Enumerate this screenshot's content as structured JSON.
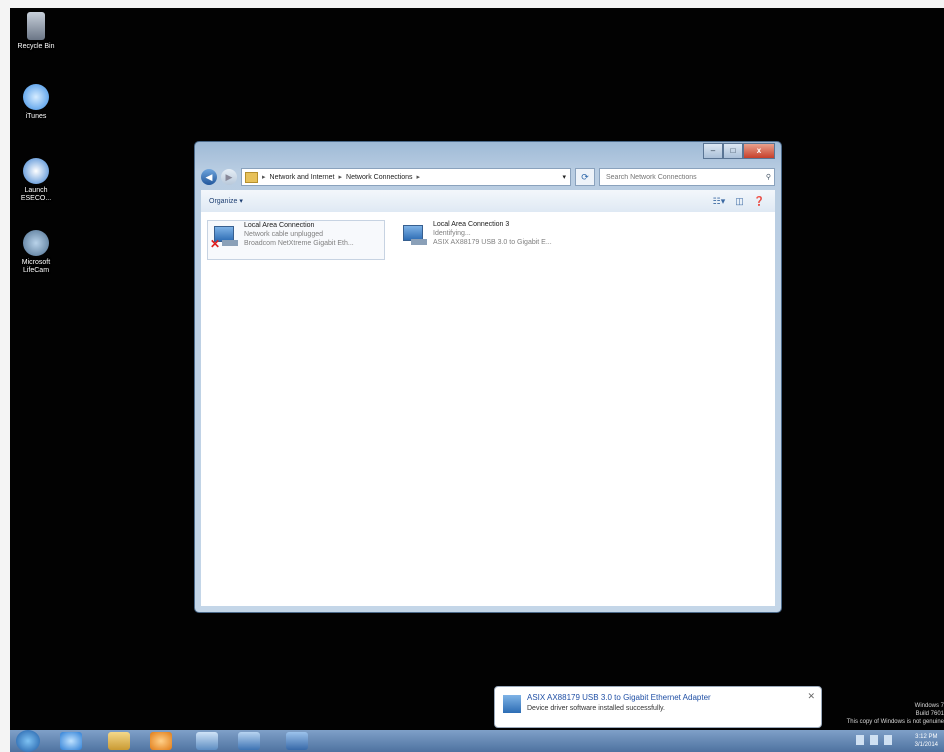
{
  "desktop": {
    "icons": [
      {
        "label": "Recycle Bin",
        "icon": "recycle-bin-icon",
        "color": "#8c96a6"
      },
      {
        "label": "iTunes",
        "icon": "itunes-icon",
        "color": "#3a8ee6"
      },
      {
        "label": "Launch ESECO...",
        "icon": "launch-icon",
        "color": "#3a7fd0"
      },
      {
        "label": "Microsoft LifeCam",
        "icon": "lifecam-icon",
        "color": "#4d6f90"
      }
    ]
  },
  "window": {
    "caption": {
      "minimize": "–",
      "maximize": "□",
      "close": "x"
    },
    "breadcrumb": [
      "Network and Internet",
      "Network Connections"
    ],
    "search_placeholder": "Search Network Connections",
    "toolbar": {
      "organize": "Organize ▾"
    },
    "connections": [
      {
        "name": "Local Area Connection",
        "status": "Network cable unplugged",
        "device": "Broadcom NetXtreme Gigabit Eth...",
        "disconnected": true
      },
      {
        "name": "Local Area Connection 3",
        "status": "Identifying...",
        "device": "ASIX AX88179 USB 3.0 to Gigabit E...",
        "disconnected": false
      }
    ]
  },
  "notification": {
    "title": "ASIX AX88179 USB 3.0 to Gigabit Ethernet Adapter",
    "body": "Device driver software installed successfully."
  },
  "watermark": {
    "line1": "Windows 7",
    "line2": "Build 7601",
    "line3": "This copy of Windows is not genuine"
  },
  "taskbar": {
    "time": "3:12 PM",
    "date": "3/1/2014"
  }
}
